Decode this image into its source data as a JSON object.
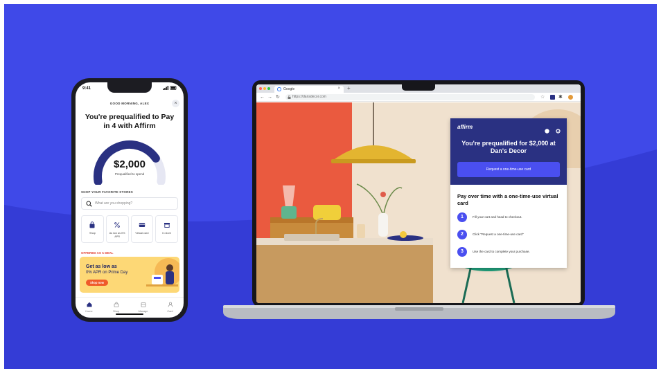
{
  "colors": {
    "background": "#3f49e8",
    "background_dark": "#343cd6",
    "affirm_navy": "#2a3182",
    "affirm_blue": "#4a4ff0",
    "promo_yellow": "#fdd876",
    "promo_orange": "#ef5a2a"
  },
  "phone": {
    "time": "9:41",
    "greeting": "GOOD MORNING, ALEX",
    "headline": "You're prequalified to Pay in 4 with Affirm",
    "amount": "$2,000",
    "amount_sub": "Prequalified to spend",
    "gauge_fill": 0.78,
    "shop_heading": "SHOP YOUR FAVORITE STORES",
    "search_placeholder": "What are you shopping?",
    "actions": [
      {
        "label": "Shop",
        "icon": "bag-icon"
      },
      {
        "label": "As low as 0% APR",
        "icon": "percent-icon"
      },
      {
        "label": "Virtual card",
        "icon": "card-icon"
      },
      {
        "label": "In store",
        "icon": "store-icon"
      }
    ],
    "offered_heading": "OFFERED AS A DEAL",
    "promo": {
      "title": "Get as low as",
      "subtitle": "0% APR on Prime Day",
      "button": "Shop now"
    },
    "tabs": [
      {
        "label": "Home"
      },
      {
        "label": "Shop"
      },
      {
        "label": "Manage"
      },
      {
        "label": "Card"
      }
    ]
  },
  "browser": {
    "tab_title": "Google",
    "url": "https://dansdecor.com"
  },
  "affirm_modal": {
    "logo": "affirm",
    "headline": "You're prequalified for $2,000 at Dan's Decor",
    "cta": "Request a one-time-use card",
    "subhead": "Pay over time with a one-time-use virtual card",
    "steps": [
      {
        "num": "1",
        "text": "Fill your cart and head to checkout."
      },
      {
        "num": "2",
        "text": "Click \"Request a one-time-use card\""
      },
      {
        "num": "3",
        "text": "Use the card to complete your purchase."
      }
    ]
  }
}
